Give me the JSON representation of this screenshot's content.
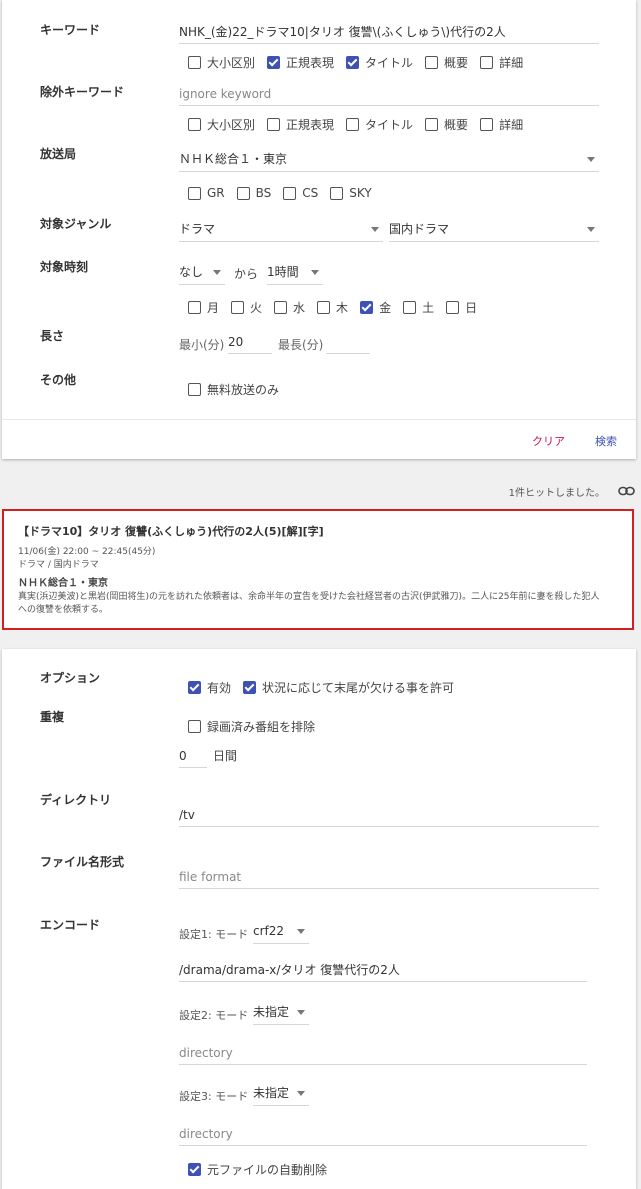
{
  "search": {
    "keyword": {
      "label": "キーワード",
      "value": "NHK_(金)22_ドラマ10|タリオ 復讐\\(ふくしゅう\\)代行の2人",
      "options": [
        {
          "label": "大小区別",
          "checked": false
        },
        {
          "label": "正規表現",
          "checked": true
        },
        {
          "label": "タイトル",
          "checked": true
        },
        {
          "label": "概要",
          "checked": false
        },
        {
          "label": "詳細",
          "checked": false
        }
      ]
    },
    "ignore_keyword": {
      "label": "除外キーワード",
      "placeholder": "ignore keyword",
      "options": [
        {
          "label": "大小区別",
          "checked": false
        },
        {
          "label": "正規表現",
          "checked": false
        },
        {
          "label": "タイトル",
          "checked": false
        },
        {
          "label": "概要",
          "checked": false
        },
        {
          "label": "詳細",
          "checked": false
        }
      ]
    },
    "station": {
      "label": "放送局",
      "value": "ＮＨＫ総合１・東京",
      "types": [
        {
          "label": "GR",
          "checked": false
        },
        {
          "label": "BS",
          "checked": false
        },
        {
          "label": "CS",
          "checked": false
        },
        {
          "label": "SKY",
          "checked": false
        }
      ]
    },
    "genre": {
      "label": "対象ジャンル",
      "main": "ドラマ",
      "sub": "国内ドラマ"
    },
    "time": {
      "label": "対象時刻",
      "start": "なし",
      "from_text": "から",
      "length": "1時間",
      "days": [
        {
          "label": "月",
          "checked": false
        },
        {
          "label": "火",
          "checked": false
        },
        {
          "label": "水",
          "checked": false
        },
        {
          "label": "木",
          "checked": false
        },
        {
          "label": "金",
          "checked": true
        },
        {
          "label": "土",
          "checked": false
        },
        {
          "label": "日",
          "checked": false
        }
      ]
    },
    "duration": {
      "label": "長さ",
      "min_label": "最小(分)",
      "min_value": "20",
      "max_label": "最長(分)",
      "max_value": ""
    },
    "other": {
      "label": "その他",
      "free_label": "無料放送のみ",
      "free_checked": false
    },
    "actions": {
      "clear": "クリア",
      "search": "検索"
    }
  },
  "hit_text": "1件ヒットしました。",
  "result": {
    "title": "【ドラマ10】タリオ 復讐(ふくしゅう)代行の2人(5)[解][字]",
    "time": "11/06(金) 22:00 ~ 22:45(45分)",
    "genre": "ドラマ / 国内ドラマ",
    "channel": "ＮＨＫ総合１・東京",
    "description": "真実(浜辺美波)と黒岩(岡田将生)の元を訪れた依頼者は、余命半年の宣告を受けた会社経営者の古沢(伊武雅刀)。二人に25年前に妻を殺した犯人への復讐を依頼する。"
  },
  "rule": {
    "option": {
      "label": "オプション",
      "enabled_label": "有効",
      "enabled_checked": true,
      "allow_label": "状況に応じて末尾が欠ける事を許可",
      "allow_checked": true
    },
    "dup": {
      "label": "重複",
      "exclude_label": "録画済み番組を排除",
      "exclude_checked": false,
      "days_value": "0",
      "days_unit": "日間"
    },
    "directory": {
      "label": "ディレクトリ",
      "value": "/tv"
    },
    "file_format": {
      "label": "ファイル名形式",
      "placeholder": "file format"
    },
    "encode": {
      "label": "エンコード",
      "settings": [
        {
          "label": "設定1: モード",
          "mode": "crf22",
          "value": "/drama/drama-x/タリオ 復讐代行の2人",
          "placeholder": "directory"
        },
        {
          "label": "設定2: モード",
          "mode": "未指定",
          "value": "",
          "placeholder": "directory"
        },
        {
          "label": "設定3: モード",
          "mode": "未指定",
          "value": "",
          "placeholder": "directory"
        }
      ],
      "auto_delete_label": "元ファイルの自動削除",
      "auto_delete_checked": true
    }
  },
  "colors": {
    "accent": "#3f51b5",
    "clear_button": "#c2185b",
    "highlight_border": "#d21f1f"
  }
}
